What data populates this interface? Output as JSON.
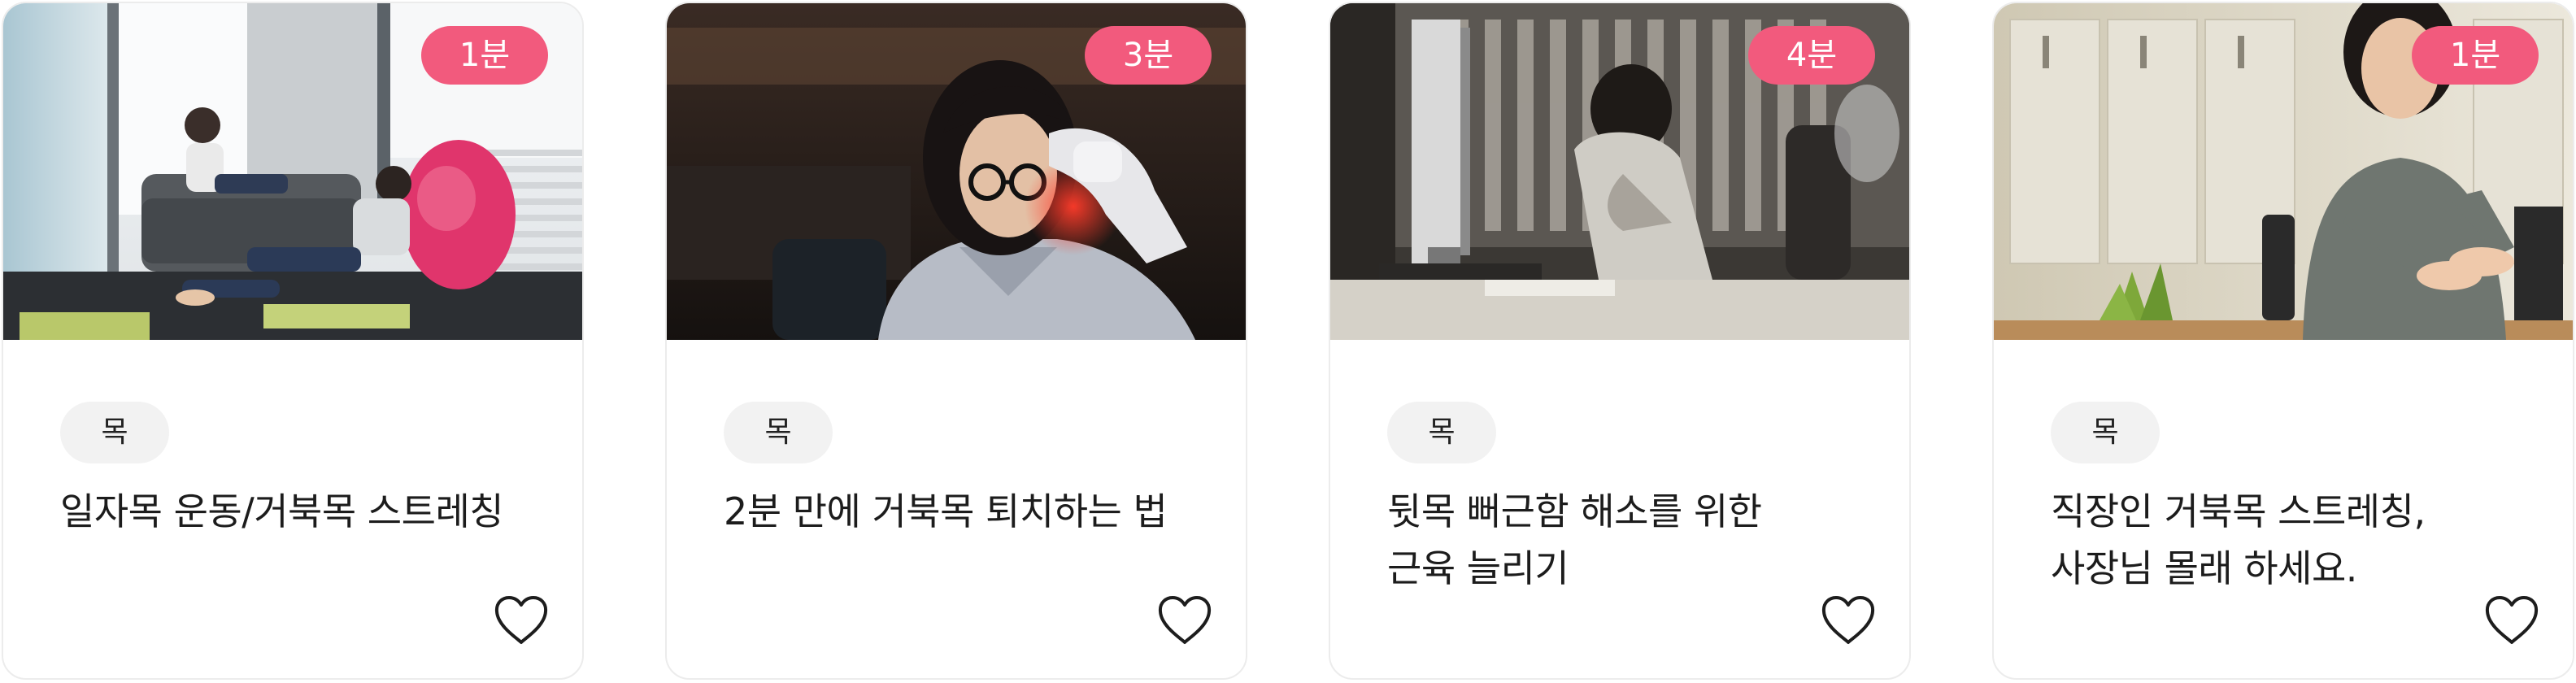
{
  "colors": {
    "badge_bg": "#f25a7d",
    "chip_bg": "#f2f2f2",
    "card_border": "#ececec"
  },
  "cards": [
    {
      "duration": "1분",
      "category": "목",
      "title": "일자목 운동/거북목 스트레칭",
      "image": "two-women-relaxing-on-sofa-photo",
      "like_icon": "heart-outline-icon"
    },
    {
      "duration": "3분",
      "category": "목",
      "title": "2분 만에 거북목 퇴치하는 법",
      "image": "woman-holding-painful-neck-photo",
      "like_icon": "heart-outline-icon"
    },
    {
      "duration": "4분",
      "category": "목",
      "title": "뒷목 뻐근함 해소를 위한\n근육 늘리기",
      "image": "tired-woman-at-office-desk-photo",
      "like_icon": "heart-outline-icon"
    },
    {
      "duration": "1분",
      "category": "목",
      "title": "직장인 거북목 스트레칭,\n사장님 몰래 하세요.",
      "image": "woman-stretching-arms-at-desk-photo",
      "like_icon": "heart-outline-icon"
    }
  ]
}
